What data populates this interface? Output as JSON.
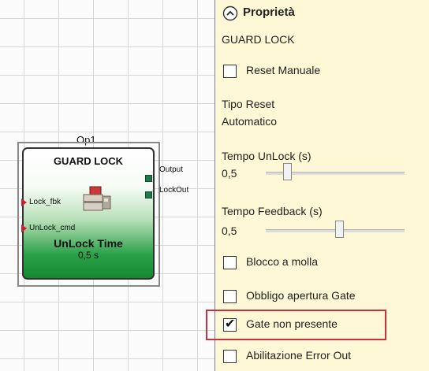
{
  "block": {
    "op_label": "Op1",
    "title": "GUARD LOCK",
    "outputs": [
      "Output",
      "LockOut"
    ],
    "inputs": [
      "Lock_fbk",
      "UnLock_cmd"
    ],
    "unlock_time_label": "UnLock Time",
    "unlock_time_value": "0,5 s"
  },
  "properties": {
    "header": "Proprietà",
    "component_name": "GUARD LOCK",
    "reset_manuale": {
      "label": "Reset Manuale",
      "checked": false
    },
    "tipo_reset_label": "Tipo Reset",
    "tipo_reset_value": "Automatico",
    "tempo_unlock": {
      "label": "Tempo UnLock (s)",
      "value": "0,5",
      "slider_fraction": 0.16
    },
    "tempo_feedback": {
      "label": "Tempo Feedback (s)",
      "value": "0,5",
      "slider_fraction": 0.52
    },
    "blocco_a_molla": {
      "label": "Blocco a molla",
      "checked": false
    },
    "obbligo_apertura": {
      "label": "Obbligo apertura Gate",
      "checked": false
    },
    "gate_non_presente": {
      "label": "Gate non presente",
      "checked": true
    },
    "abilitazione_error": {
      "label": "Abilitazione Error Out",
      "checked": false
    }
  },
  "colors": {
    "panel_bg": "#fff8d6",
    "highlight": "#c8323c",
    "pin_input": "#d8182a",
    "pin_output": "#1e7a4a"
  }
}
